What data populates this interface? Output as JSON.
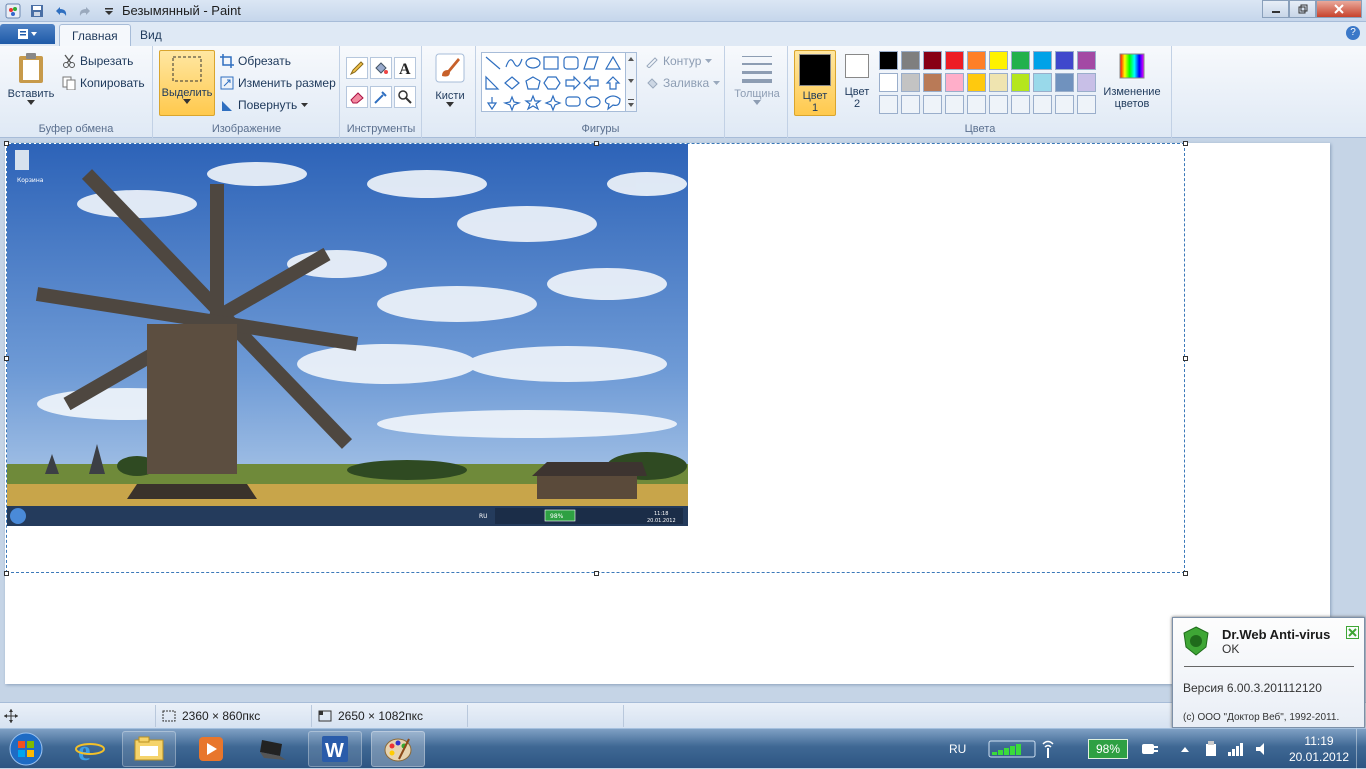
{
  "window": {
    "title": "Безымянный - Paint"
  },
  "tabs": [
    {
      "label": "Главная"
    },
    {
      "label": "Вид"
    }
  ],
  "ribbon": {
    "clipboard": {
      "paste": "Вставить",
      "cut": "Вырезать",
      "copy": "Копировать",
      "label": "Буфер обмена"
    },
    "image": {
      "select": "Выделить",
      "crop": "Обрезать",
      "resize": "Изменить размер",
      "rotate": "Повернуть",
      "label": "Изображение"
    },
    "tools": {
      "label": "Инструменты"
    },
    "brushes": {
      "label": "Кисти"
    },
    "shapes": {
      "outline": "Контур",
      "fill": "Заливка",
      "label": "Фигуры"
    },
    "size": {
      "label": "Толщина"
    },
    "colors": {
      "color1_line1": "Цвет",
      "color1_line2": "1",
      "color2_line1": "Цвет",
      "color2_line2": "2",
      "edit_line1": "Изменение",
      "edit_line2": "цветов",
      "label": "Цвета",
      "palette": [
        "#000000",
        "#7f7f7f",
        "#880015",
        "#ed1c24",
        "#ff7f27",
        "#fff200",
        "#22b14c",
        "#00a2e8",
        "#3f48cc",
        "#a349a4",
        "#ffffff",
        "#c3c3c3",
        "#b97a57",
        "#ffaec9",
        "#ffc90e",
        "#efe4b0",
        "#b5e61d",
        "#99d9ea",
        "#7092be",
        "#c8bfe7"
      ]
    }
  },
  "status": {
    "selection_size": "2360 × 860пкс",
    "image_size": "2650 × 1082пкс"
  },
  "photo": {
    "recycle_label": "Корзина",
    "lang": "RU",
    "battery": "98%",
    "time": "11:18",
    "date": "20.01.2012"
  },
  "notification": {
    "title": "Dr.Web Anti-virus",
    "status": "OK",
    "version": "Версия 6.00.3.201112120",
    "copyright": "(c) ООО \"Доктор Веб\", 1992-2011."
  },
  "taskbar": {
    "lang": "RU",
    "battery": "98%",
    "time": "11:19",
    "date": "20.01.2012"
  }
}
